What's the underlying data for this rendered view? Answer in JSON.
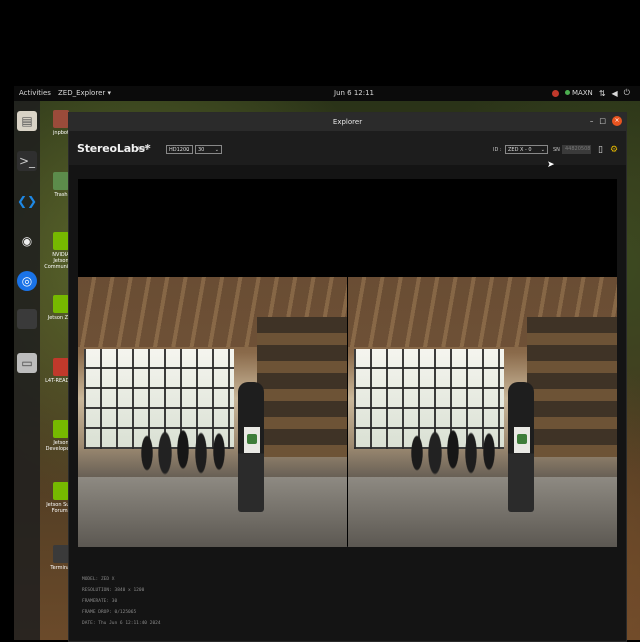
{
  "topbar": {
    "activities": "Activities",
    "app_menu": "ZED_Explorer ▾",
    "clock": "Jun 6  12:11",
    "power_mode": "MAXN"
  },
  "dock": {
    "items": [
      {
        "icon": "files-icon"
      },
      {
        "icon": "terminal-icon"
      },
      {
        "icon": "vscode-icon"
      },
      {
        "icon": "obs-icon"
      },
      {
        "icon": "chromium-icon"
      },
      {
        "icon": "blank-app-icon"
      },
      {
        "icon": "drive-icon"
      }
    ]
  },
  "desktop_icons": [
    {
      "label": "jnpbot"
    },
    {
      "label": "Trash"
    },
    {
      "label": "NVIDIA Jetson Community P"
    },
    {
      "label": "Jetson Zoo"
    },
    {
      "label": "L4T-README"
    },
    {
      "label": "Jetson Developer Z"
    },
    {
      "label": "Jetson Supp Forums"
    },
    {
      "label": "Terminal"
    }
  ],
  "window": {
    "title": "Explorer",
    "controls": [
      "–",
      "□",
      "×"
    ]
  },
  "toolbar": {
    "logo": "StereoLabs*",
    "live_label": "LIVE",
    "resolution": "HD1200",
    "fps": "30",
    "id_label": "ID :",
    "camera_select": "ZED X - 0",
    "sn_label": "SN :",
    "serial": "44820508"
  },
  "info": {
    "model": "MODEL: ZED X",
    "resolution": "RESOLUTION: 3840 x 1200",
    "framerate": "FRAMERATE: 30",
    "frame_drop": "FRAME DROP: 0/125065",
    "date": "DATE: Thu Jun 6 12:11:40 2024"
  }
}
